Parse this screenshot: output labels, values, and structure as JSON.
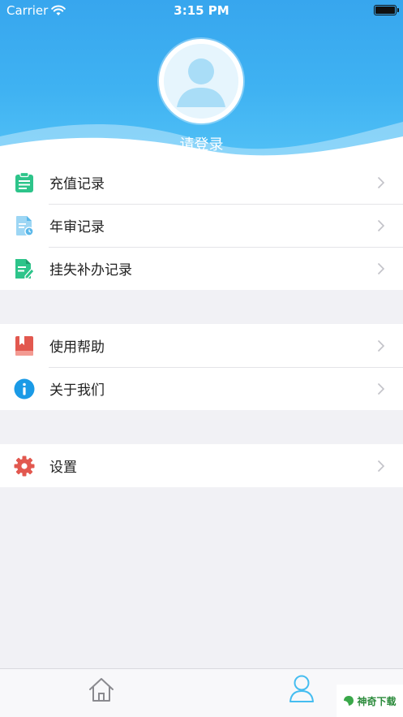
{
  "status_bar": {
    "carrier": "Carrier",
    "time": "3:15 PM"
  },
  "profile": {
    "login_label": "请登录",
    "avatar_icon": "user-avatar-icon"
  },
  "menu_groups": [
    [
      {
        "label": "充值记录",
        "icon": "clipboard-icon",
        "color": "#2dc48a"
      },
      {
        "label": "年审记录",
        "icon": "document-icon",
        "color": "#5ab8ea"
      },
      {
        "label": "挂失补办记录",
        "icon": "edit-document-icon",
        "color": "#2dc48a"
      }
    ],
    [
      {
        "label": "使用帮助",
        "icon": "book-icon",
        "color": "#e2584f"
      },
      {
        "label": "关于我们",
        "icon": "info-icon",
        "color": "#1a9ae6"
      }
    ],
    [
      {
        "label": "设置",
        "icon": "gear-icon",
        "color": "#e2584f"
      }
    ]
  ],
  "tabbar": {
    "tabs": [
      {
        "name": "home",
        "icon": "home-icon",
        "active": false
      },
      {
        "name": "me",
        "icon": "person-icon",
        "active": true
      }
    ],
    "accent": "#45bdf0"
  },
  "watermark": {
    "text": "神奇下载"
  }
}
